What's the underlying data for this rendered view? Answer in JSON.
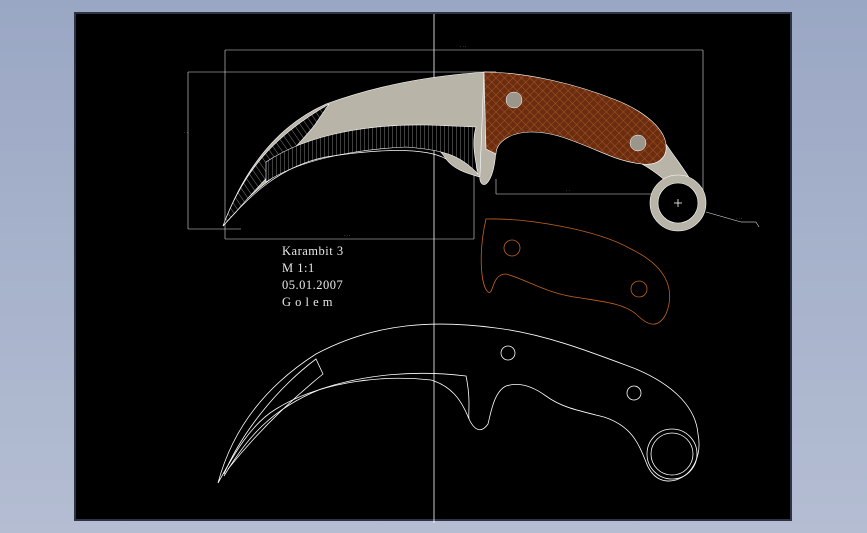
{
  "drawing": {
    "title": "Karambit 3",
    "scale": "M  1:1",
    "date": "05.01.2007",
    "author": "G o l e m"
  },
  "colors": {
    "background": "#000000",
    "blade": "#b8b4a8",
    "handle": "#6b2d12",
    "hatch": "#c0641e",
    "lines": "#ffffff"
  },
  "icons": {
    "ring_center_mark": "crosshair-icon"
  }
}
